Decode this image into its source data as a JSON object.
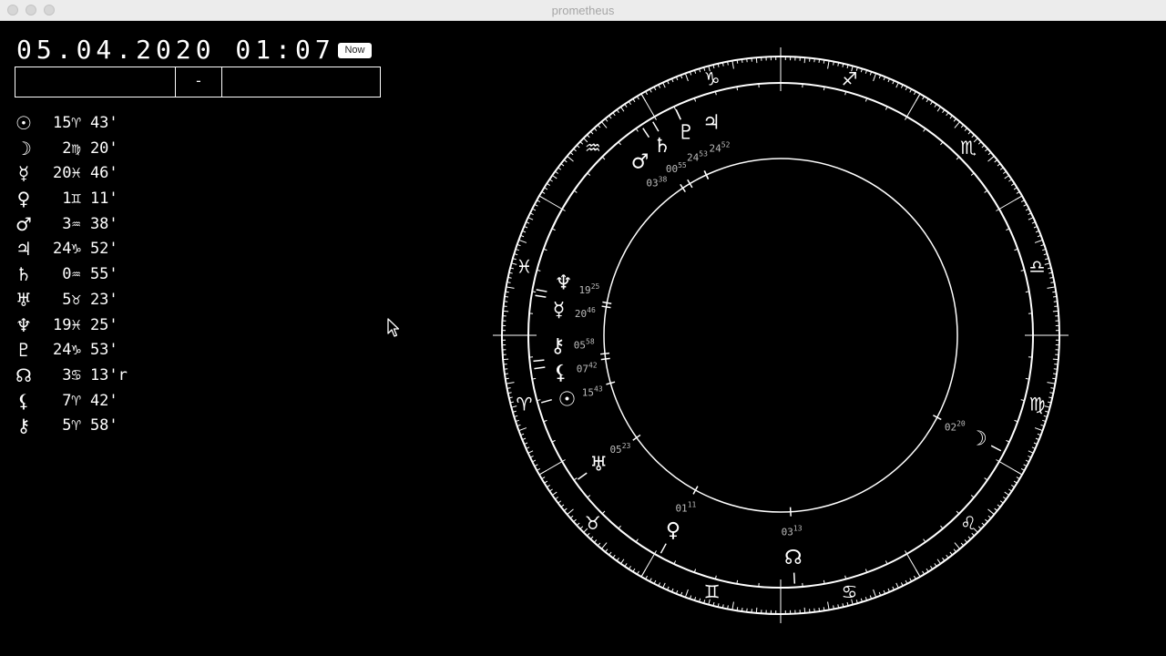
{
  "window": {
    "title": "prometheus"
  },
  "header": {
    "datetime": "05.04.2020 01:07",
    "now_label": "Now"
  },
  "inputs": {
    "left_value": "",
    "middle_label": "-",
    "right_value": ""
  },
  "planets": [
    {
      "icon": "sun-icon",
      "glyph": "☉",
      "position": "15♈ 43'"
    },
    {
      "icon": "moon-icon",
      "glyph": "☽",
      "position": " 2♍ 20'"
    },
    {
      "icon": "mercury-icon",
      "glyph": "☿",
      "position": "20♓ 46'"
    },
    {
      "icon": "venus-icon",
      "glyph": "♀",
      "position": " 1♊ 11'"
    },
    {
      "icon": "mars-icon",
      "glyph": "♂",
      "position": " 3♒ 38'"
    },
    {
      "icon": "jupiter-icon",
      "glyph": "♃",
      "position": "24♑ 52'"
    },
    {
      "icon": "saturn-icon",
      "glyph": "♄",
      "position": " 0♒ 55'"
    },
    {
      "icon": "uranus-icon",
      "glyph": "♅",
      "position": " 5♉ 23'"
    },
    {
      "icon": "neptune-icon",
      "glyph": "♆",
      "position": "19♓ 25'"
    },
    {
      "icon": "pluto-icon",
      "glyph": "♇",
      "position": "24♑ 53'"
    },
    {
      "icon": "north-node-icon",
      "glyph": "☊",
      "position": " 3♋ 13'r"
    },
    {
      "icon": "lilith-icon",
      "glyph": "⚸",
      "position": " 7♈ 42'"
    },
    {
      "icon": "chiron-icon",
      "glyph": "⚷",
      "position": " 5♈ 58'"
    }
  ],
  "chart": {
    "ascendant_deg": 360,
    "zodiac": [
      {
        "name": "aries",
        "glyph": "♈"
      },
      {
        "name": "taurus",
        "glyph": "♉"
      },
      {
        "name": "gemini",
        "glyph": "♊"
      },
      {
        "name": "cancer",
        "glyph": "♋"
      },
      {
        "name": "leo",
        "glyph": "♌"
      },
      {
        "name": "virgo",
        "glyph": "♍"
      },
      {
        "name": "libra",
        "glyph": "♎"
      },
      {
        "name": "scorpio",
        "glyph": "♏"
      },
      {
        "name": "sagittarius",
        "glyph": "♐"
      },
      {
        "name": "capricorn",
        "glyph": "♑"
      },
      {
        "name": "aquarius",
        "glyph": "♒"
      },
      {
        "name": "pisces",
        "glyph": "♓"
      }
    ],
    "bodies": [
      {
        "name": "sun",
        "glyph": "☉",
        "lon": 15.717,
        "deg": "15",
        "min": "43"
      },
      {
        "name": "moon",
        "glyph": "☽",
        "lon": 152.333,
        "deg": "02",
        "min": "20"
      },
      {
        "name": "mercury",
        "glyph": "☿",
        "lon": 350.767,
        "deg": "20",
        "min": "46"
      },
      {
        "name": "venus",
        "glyph": "♀",
        "lon": 61.183,
        "deg": "01",
        "min": "11"
      },
      {
        "name": "mars",
        "glyph": "♂",
        "lon": 303.633,
        "deg": "03",
        "min": "38"
      },
      {
        "name": "jupiter",
        "glyph": "♃",
        "lon": 294.867,
        "deg": "24",
        "min": "52"
      },
      {
        "name": "saturn",
        "glyph": "♄",
        "lon": 300.917,
        "deg": "00",
        "min": "55"
      },
      {
        "name": "uranus",
        "glyph": "♅",
        "lon": 35.383,
        "deg": "05",
        "min": "23"
      },
      {
        "name": "neptune",
        "glyph": "♆",
        "lon": 349.417,
        "deg": "19",
        "min": "25"
      },
      {
        "name": "pluto",
        "glyph": "♇",
        "lon": 294.883,
        "deg": "24",
        "min": "53"
      },
      {
        "name": "north-node",
        "glyph": "☊",
        "lon": 93.217,
        "deg": "03",
        "min": "13"
      },
      {
        "name": "lilith",
        "glyph": "⚸",
        "lon": 7.7,
        "deg": "07",
        "min": "42"
      },
      {
        "name": "chiron",
        "glyph": "⚷",
        "lon": 5.967,
        "deg": "05",
        "min": "58"
      }
    ]
  }
}
